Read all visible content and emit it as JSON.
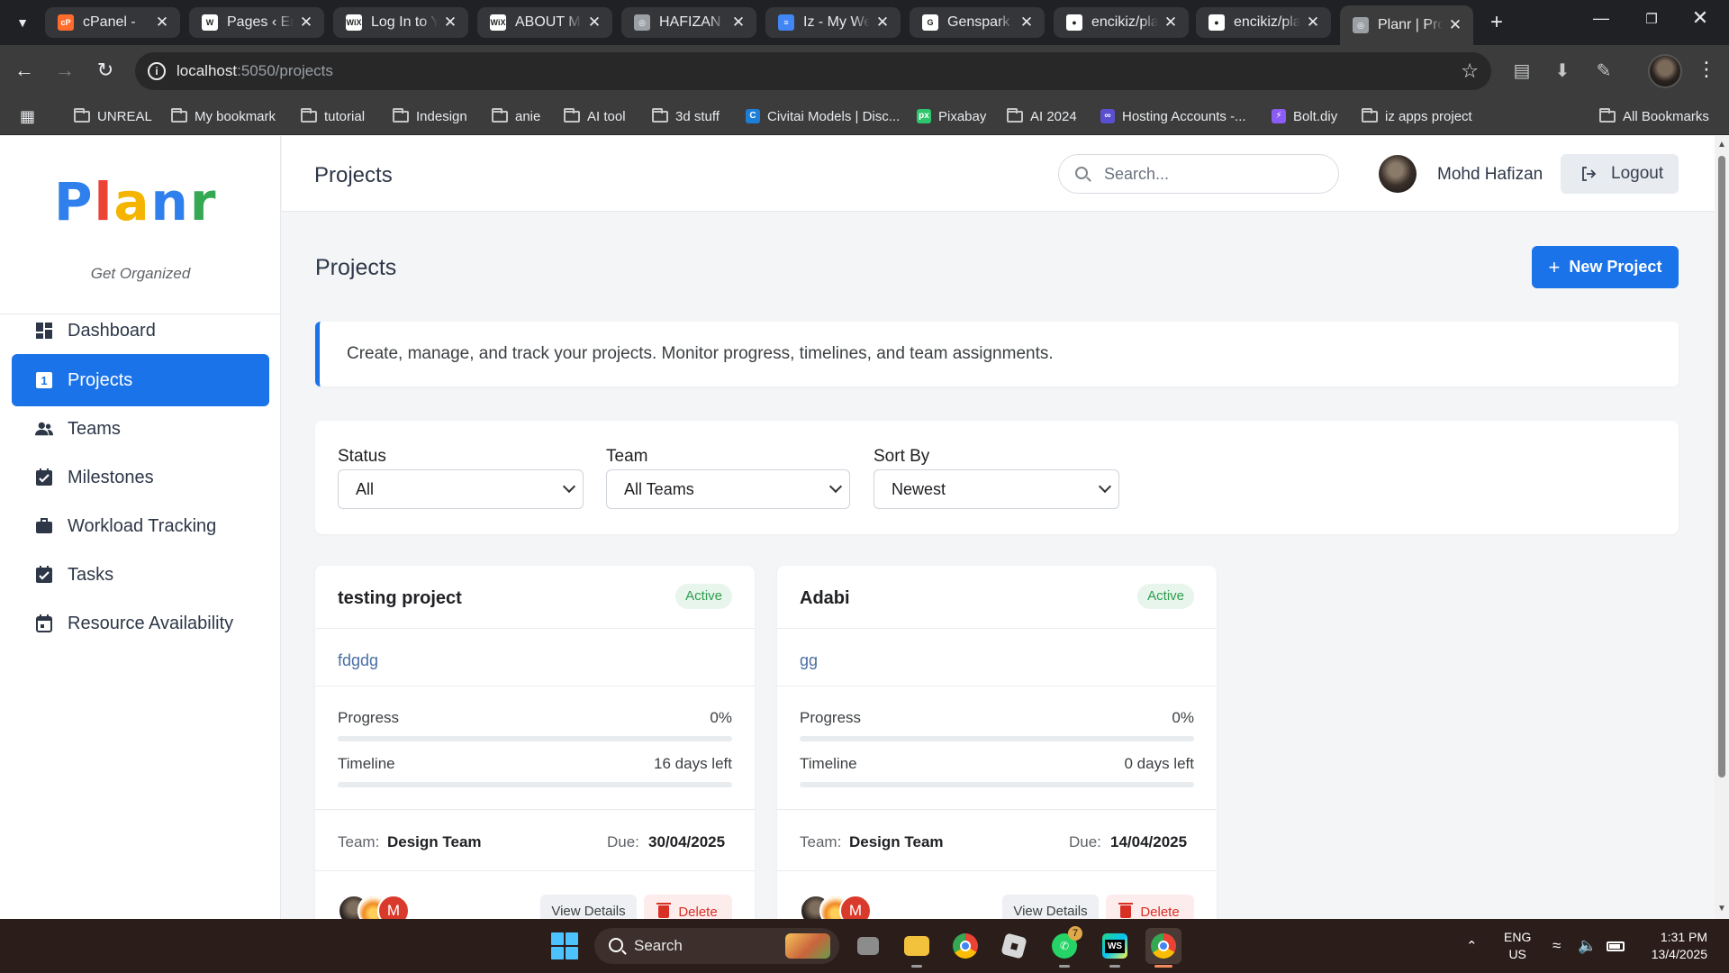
{
  "browser": {
    "tabs": [
      {
        "title": "cPanel -",
        "favicon_color": "#ff6c2c",
        "favicon": "cP"
      },
      {
        "title": "Pages ‹ Enc",
        "favicon_color": "#ffffff",
        "favicon": "W"
      },
      {
        "title": "Log In to Y",
        "favicon_color": "#ffffff",
        "favicon": "WiX"
      },
      {
        "title": "ABOUT ME",
        "favicon_color": "#ffffff",
        "favicon": "WiX"
      },
      {
        "title": "HAFIZAN P",
        "favicon_color": "#9aa0a6",
        "favicon": "◎"
      },
      {
        "title": "Iz - My We",
        "favicon_color": "#4285f4",
        "favicon": "≡"
      },
      {
        "title": "Genspark -",
        "favicon_color": "#ffffff",
        "favicon": "G"
      },
      {
        "title": "encikiz/pla",
        "favicon_color": "#ffffff",
        "favicon": "●"
      },
      {
        "title": "encikiz/pla",
        "favicon_color": "#ffffff",
        "favicon": "●"
      },
      {
        "title": "Planr | Proj",
        "favicon_color": "#9aa0a6",
        "favicon": "◎"
      }
    ],
    "url_host": "localhost",
    "url_path": ":5050/projects",
    "bookmarks": [
      {
        "label": "UNREAL",
        "type": "folder"
      },
      {
        "label": "My bookmark",
        "type": "folder"
      },
      {
        "label": "tutorial",
        "type": "folder"
      },
      {
        "label": "Indesign",
        "type": "folder"
      },
      {
        "label": "anie",
        "type": "folder"
      },
      {
        "label": "AI tool",
        "type": "folder"
      },
      {
        "label": "3d stuff",
        "type": "folder"
      },
      {
        "label": "Civitai Models | Disc...",
        "type": "site",
        "color": "#1c7ed6",
        "glyph": "C"
      },
      {
        "label": "Pixabay",
        "type": "site",
        "color": "#2ec66d",
        "glyph": "px"
      },
      {
        "label": "AI 2024",
        "type": "folder"
      },
      {
        "label": "Hosting Accounts -...",
        "type": "site",
        "color": "#5a4fcf",
        "glyph": "∞"
      },
      {
        "label": "Bolt.diy",
        "type": "site",
        "color": "#8b5cf6",
        "glyph": "⚡"
      },
      {
        "label": "iz apps project",
        "type": "folder"
      }
    ],
    "all_bookmarks": "All Bookmarks"
  },
  "app": {
    "logo_letters": [
      {
        "ch": "P",
        "color": "#2f80ed"
      },
      {
        "ch": "l",
        "color": "#eb4335"
      },
      {
        "ch": "a",
        "color": "#f4b400"
      },
      {
        "ch": "n",
        "color": "#2f80ed"
      },
      {
        "ch": "r",
        "color": "#34a853"
      }
    ],
    "tagline": "Get Organized",
    "nav": [
      {
        "label": "Dashboard",
        "icon": "dashboard-icon",
        "active": false
      },
      {
        "label": "Projects",
        "icon": "projects-icon",
        "active": true
      },
      {
        "label": "Teams",
        "icon": "teams-icon",
        "active": false
      },
      {
        "label": "Milestones",
        "icon": "milestones-icon",
        "active": false
      },
      {
        "label": "Workload Tracking",
        "icon": "briefcase-icon",
        "active": false
      },
      {
        "label": "Tasks",
        "icon": "tasks-icon",
        "active": false
      },
      {
        "label": "Resource Availability",
        "icon": "calendar-icon",
        "active": false
      }
    ],
    "topbar_title": "Projects",
    "search_placeholder": "Search...",
    "user_name": "Mohd Hafizan",
    "logout_label": "Logout",
    "page_title": "Projects",
    "new_project_label": "New Project",
    "banner_text": "Create, manage, and track your projects. Monitor progress, timelines, and team assignments.",
    "filters": [
      {
        "label": "Status",
        "value": "All"
      },
      {
        "label": "Team",
        "value": "All Teams"
      },
      {
        "label": "Sort By",
        "value": "Newest"
      }
    ],
    "labels": {
      "progress": "Progress",
      "timeline": "Timeline",
      "team": "Team:",
      "due": "Due:",
      "view": "View Details",
      "delete": "Delete"
    },
    "projects": [
      {
        "name": "testing project",
        "status": "Active",
        "description": "fdgdg",
        "progress": "0%",
        "progress_value": 0,
        "timeline": "16 days left",
        "team": "Design Team",
        "due": "30/04/2025",
        "avatar_initial": "M"
      },
      {
        "name": "Adabi",
        "status": "Active",
        "description": "gg",
        "progress": "0%",
        "progress_value": 0,
        "timeline": "0 days left",
        "team": "Design Team",
        "due": "14/04/2025",
        "avatar_initial": "M"
      }
    ]
  },
  "taskbar": {
    "search_label": "Search",
    "whatsapp_badge": "7",
    "lang_line1": "ENG",
    "lang_line2": "US",
    "time": "1:31 PM",
    "date": "13/4/2025"
  }
}
